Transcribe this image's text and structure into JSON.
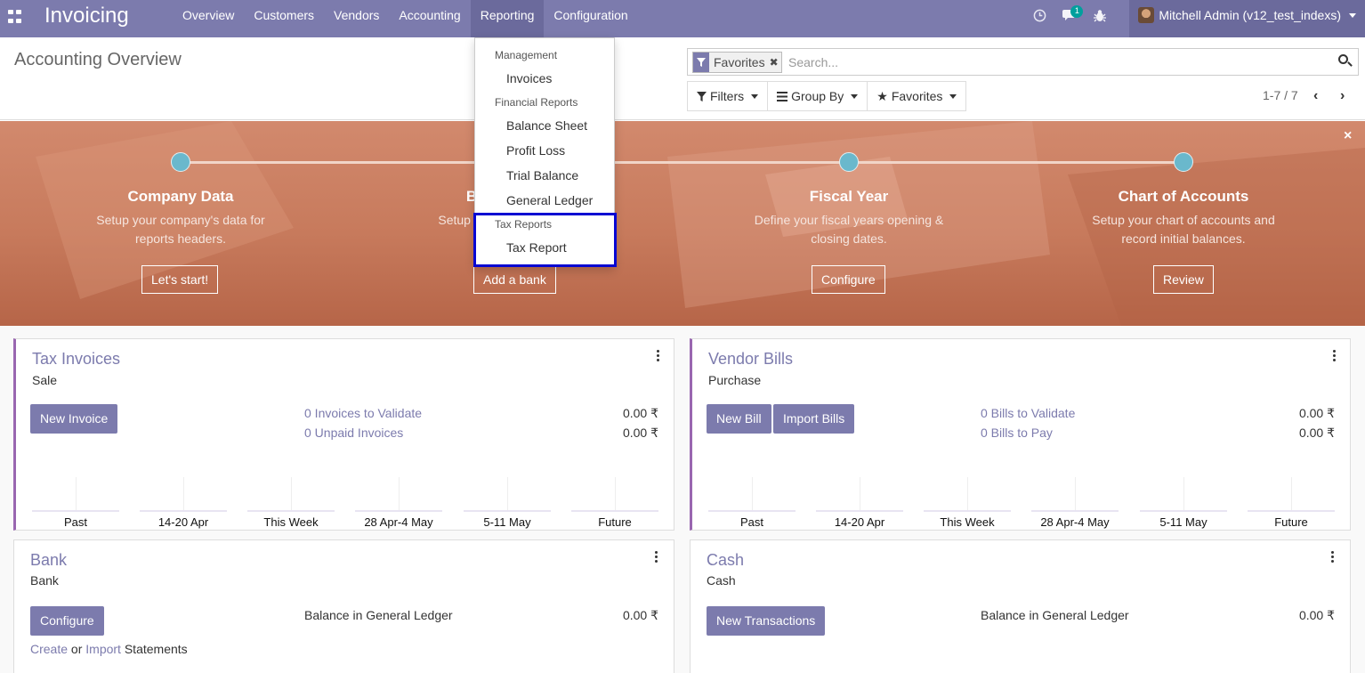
{
  "navbar": {
    "brand": "Invoicing",
    "menu": [
      "Overview",
      "Customers",
      "Vendors",
      "Accounting",
      "Reporting",
      "Configuration"
    ],
    "active_menu": "Reporting",
    "messages_badge": "1",
    "user": "Mitchell Admin (v12_test_indexs)",
    "icons": [
      "apps-icon",
      "clock-icon",
      "chat-icon",
      "bug-icon",
      "avatar"
    ]
  },
  "control_panel": {
    "title": "Accounting Overview",
    "search": {
      "facet_icon": "filter-icon",
      "facet": "Favorites",
      "placeholder": "Search..."
    },
    "filters": {
      "filters": "Filters",
      "group_by": "Group By",
      "favorites": "Favorites"
    },
    "pager": "1-7 / 7"
  },
  "reporting_menu": {
    "sections": [
      {
        "header": "Management",
        "items": [
          "Invoices"
        ]
      },
      {
        "header": "Financial Reports",
        "items": [
          "Balance Sheet",
          "Profit Loss",
          "Trial Balance",
          "General Ledger"
        ]
      },
      {
        "header": "Tax Reports",
        "items": [
          "Tax Report"
        ]
      }
    ],
    "highlight_color": "#0707d2"
  },
  "onboarding": {
    "steps": [
      {
        "title": "Company Data",
        "desc1": "Setup your company's data for",
        "desc2": "reports headers.",
        "button": "Let's start!"
      },
      {
        "title": "B",
        "desc1": "Setup yo",
        "desc2": "",
        "button": "Add a bank"
      },
      {
        "title": "Fiscal Year",
        "desc1": "Define your fiscal years opening &",
        "desc2": "closing dates.",
        "button": "Configure"
      },
      {
        "title": "Chart of Accounts",
        "desc1": "Setup your chart of accounts and",
        "desc2": "record initial balances.",
        "button": "Review"
      }
    ],
    "close": "×"
  },
  "journals": {
    "tax_invoices": {
      "title": "Tax Invoices",
      "type": "Sale",
      "button": "New Invoice",
      "links": [
        "0 Invoices to Validate",
        "0 Unpaid Invoices"
      ],
      "amounts": [
        "0.00 ₹",
        "0.00 ₹"
      ]
    },
    "vendor_bills": {
      "title": "Vendor Bills",
      "type": "Purchase",
      "button": "New Bill",
      "button2": "Import Bills",
      "links": [
        "0 Bills to Validate",
        "0 Bills to Pay"
      ],
      "amounts": [
        "0.00 ₹",
        "0.00 ₹"
      ]
    },
    "bank": {
      "title": "Bank",
      "type": "Bank",
      "button": "Configure",
      "label": "Balance in General Ledger",
      "amount": "0.00 ₹",
      "create": "Create",
      "or": "or",
      "import": "Import",
      "statements": "Statements"
    },
    "cash": {
      "title": "Cash",
      "type": "Cash",
      "button": "New Transactions",
      "label": "Balance in General Ledger",
      "amount": "0.00 ₹"
    }
  },
  "chart_labels": [
    "Past",
    "14-20 Apr",
    "This Week",
    "28 Apr-4 May",
    "5-11 May",
    "Future"
  ]
}
